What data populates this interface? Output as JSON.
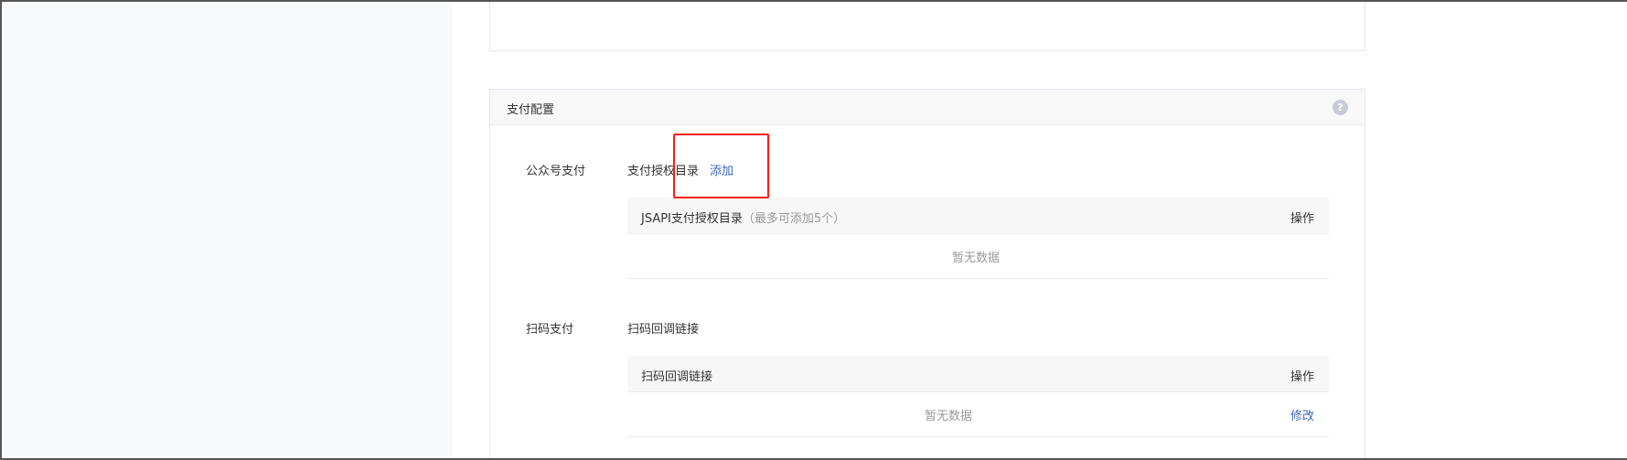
{
  "pay_config": {
    "title": "支付配置",
    "help_icon_glyph": "?",
    "help_icon": "question-circle-icon"
  },
  "official_account": {
    "section_label": "公众号支付",
    "field_label": "支付授权目录",
    "add_link": "添加",
    "table": {
      "header_title": "JSAPI支付授权目录",
      "header_hint": "（最多可添加5个）",
      "header_action": "操作",
      "empty_text": "暂无数据"
    }
  },
  "scan_pay": {
    "section_label": "扫码支付",
    "field_label": "扫码回调链接",
    "table": {
      "header_title": "扫码回调链接",
      "header_action": "操作",
      "empty_text": "暂无数据",
      "row_action": "修改"
    }
  },
  "colors": {
    "link": "#3b65b8",
    "highlight": "#ff1a1a",
    "muted": "#999999"
  }
}
